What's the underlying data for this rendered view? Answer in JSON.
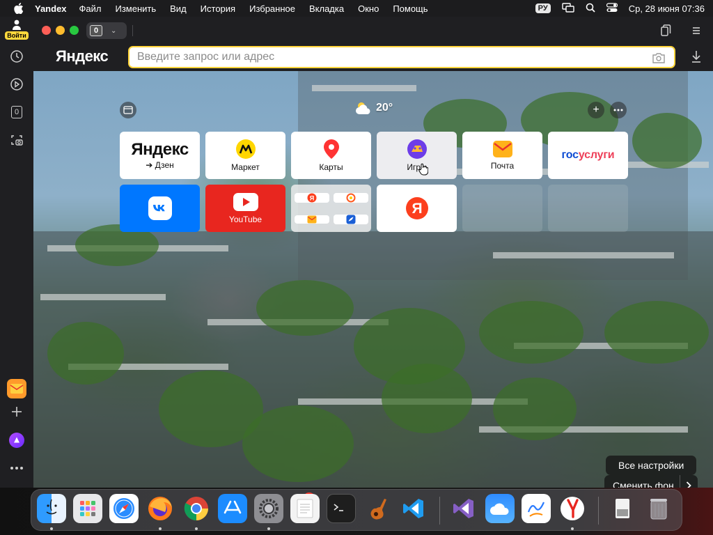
{
  "menubar": {
    "app_name": "Yandex",
    "items": [
      "Файл",
      "Изменить",
      "Вид",
      "История",
      "Избранное",
      "Вкладка",
      "Окно",
      "Помощь"
    ],
    "input_lang": "РУ",
    "datetime": "Ср, 28 июня  07:36"
  },
  "browser": {
    "login_label": "Войти",
    "tab_count": "0",
    "logo": "Яндекс",
    "address_placeholder": "Введите запрос или адрес",
    "address_value": "",
    "sidebar_tab_count": "0"
  },
  "newtab": {
    "weather_temp": "20°",
    "tiles": [
      {
        "title": "Яндекс",
        "subtitle": "➔ Дзен"
      },
      {
        "label": "Маркет"
      },
      {
        "label": "Карты"
      },
      {
        "label": "Игры"
      },
      {
        "label": "Почта"
      },
      {
        "title_a": "гос",
        "title_b": "услуги"
      },
      {
        "label": "ВКонтакте"
      },
      {
        "label": "YouTube"
      },
      {
        "label": "Папка"
      },
      {
        "label": "Я"
      }
    ],
    "all_settings": "Все настройки",
    "change_background": "Сменить фон"
  },
  "dock": {
    "settings_badge": "2",
    "apps": [
      "Finder",
      "Launchpad",
      "Safari",
      "Firefox",
      "Chrome",
      "App Store",
      "System Settings",
      "TextEdit",
      "Terminal",
      "GarageBand",
      "VS Code",
      "Visual Studio",
      "Weather",
      "Freeform",
      "Yandex",
      "Downloads",
      "Trash"
    ]
  },
  "colors": {
    "accent_yellow": "#ffd43a",
    "vk_blue": "#0077ff",
    "youtube_red": "#e8261f",
    "yandex_red": "#fc3f1d"
  }
}
